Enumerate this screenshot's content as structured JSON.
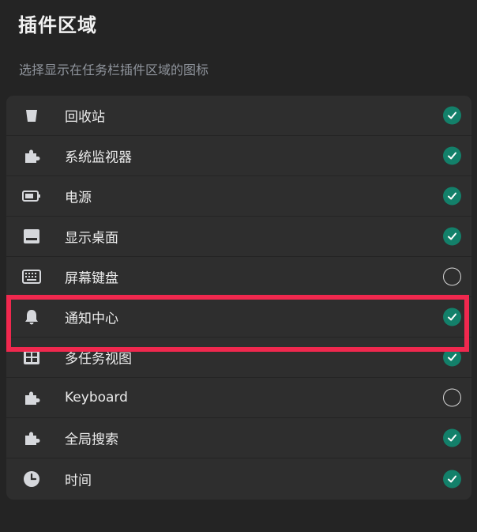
{
  "header": {
    "title": "插件区域",
    "subtitle": "选择显示在任务栏插件区域的图标"
  },
  "colors": {
    "accent": "#13806a",
    "highlight": "#f0284e",
    "background": "#242424",
    "panel": "#2e2e2e"
  },
  "plugins": [
    {
      "label": "回收站",
      "icon": "trash-icon",
      "checked": true
    },
    {
      "label": "系统监视器",
      "icon": "puzzle-icon",
      "checked": true
    },
    {
      "label": "电源",
      "icon": "battery-icon",
      "checked": true
    },
    {
      "label": "显示桌面",
      "icon": "desktop-icon",
      "checked": true
    },
    {
      "label": "屏幕键盘",
      "icon": "keyboard-icon",
      "checked": false
    },
    {
      "label": "通知中心",
      "icon": "bell-icon",
      "checked": true
    },
    {
      "label": "多任务视图",
      "icon": "grid-icon",
      "checked": true
    },
    {
      "label": "Keyboard",
      "icon": "puzzle-icon",
      "checked": false
    },
    {
      "label": "全局搜索",
      "icon": "puzzle-icon",
      "checked": true
    },
    {
      "label": "时间",
      "icon": "clock-icon",
      "checked": true
    }
  ]
}
